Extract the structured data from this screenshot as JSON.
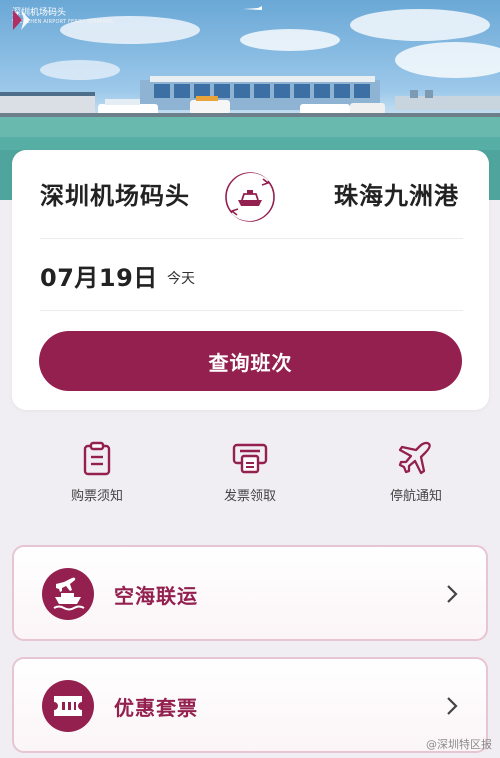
{
  "brand": {
    "logo_text": "深圳机场码头",
    "logo_sub": "SHENZHEN AIRPORT FERRY TERMINAL",
    "accent_color": "#93204f"
  },
  "route": {
    "origin": "深圳机场码头",
    "destination": "珠海九洲港",
    "swap_icon": "ferry-swap-icon"
  },
  "date": {
    "value": "07月19日",
    "tag": "今天"
  },
  "search_button": "查询班次",
  "quick_links": [
    {
      "label": "购票须知",
      "icon": "clipboard-icon"
    },
    {
      "label": "发票领取",
      "icon": "printer-icon"
    },
    {
      "label": "停航通知",
      "icon": "airplane-icon"
    }
  ],
  "menu": [
    {
      "label": "空海联运",
      "icon": "plane-ship-icon"
    },
    {
      "label": "优惠套票",
      "icon": "ticket-icon"
    }
  ],
  "watermark": "@深圳特区报"
}
